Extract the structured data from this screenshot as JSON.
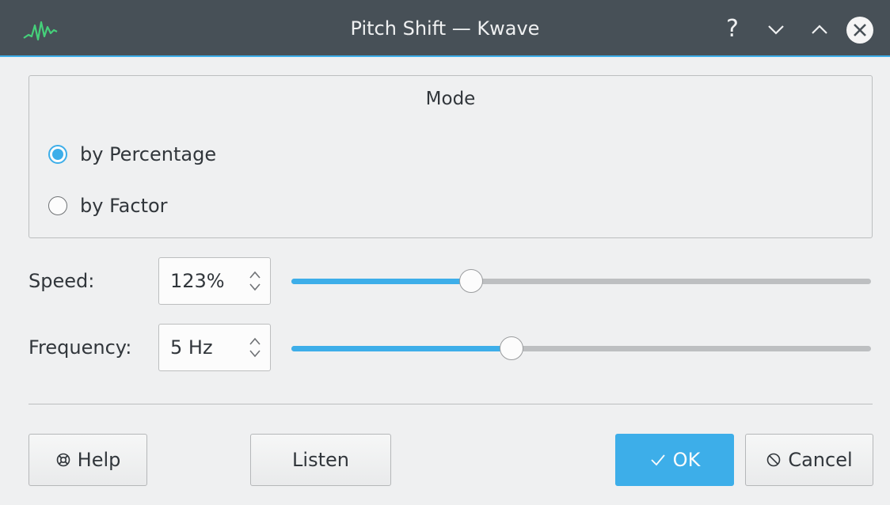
{
  "window": {
    "title": "Pitch Shift — Kwave",
    "help_glyph": "?",
    "icons": [
      "kwave-app-icon",
      "help-icon",
      "minimize-icon",
      "maximize-icon",
      "close-icon"
    ]
  },
  "mode_group": {
    "title": "Mode",
    "options": [
      {
        "label": "by Percentage",
        "checked": true
      },
      {
        "label": "by Factor",
        "checked": false
      }
    ]
  },
  "speed": {
    "label": "Speed:",
    "value": "123%",
    "slider_fraction": 0.31
  },
  "frequency": {
    "label": "Frequency:",
    "value": "5 Hz",
    "slider_fraction": 0.38
  },
  "buttons": {
    "help": "Help",
    "listen": "Listen",
    "ok": "OK",
    "cancel": "Cancel"
  },
  "colors": {
    "accent": "#3daee9",
    "titlebar": "#475057",
    "background": "#eff0f1"
  }
}
